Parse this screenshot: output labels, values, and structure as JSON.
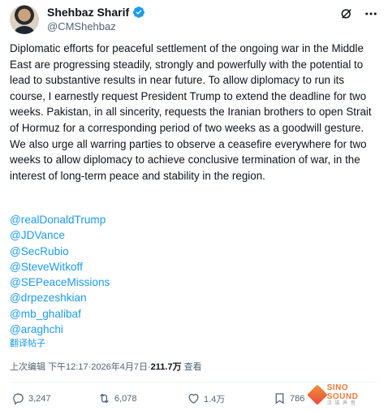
{
  "post": {
    "author": {
      "display_name": "Shehbaz Sharif",
      "handle": "@CMShehbaz",
      "verified": true,
      "verified_color": "#1d9bf0"
    },
    "text": "Diplomatic efforts for peaceful settlement of the ongoing war in the Middle East are progressing steadily, strongly and powerfully with the potential to lead to substantive results in near future. To allow diplomacy to run its course, I earnestly request President Trump to extend the deadline for two weeks. Pakistan, in all sincerity, requests the Iranian brothers to open Strait of Hormuz for a corresponding period of two weeks as a goodwill gesture. We also urge all warring parties to observe a ceasefire everywhere for two weeks to allow diplomacy to achieve conclusive termination of war, in the interest of long-term peace and stability in the region.",
    "mentions": [
      "@realDonaldTrump",
      "@JDVance",
      "@SecRubio",
      "@SteveWitkoff",
      "@SEPeaceMissions",
      "@drpezeshkian",
      "@mb_ghalibaf",
      "@araghchi"
    ],
    "translate_label": "翻译帖子",
    "meta": {
      "edited_label": "上次编辑",
      "time": "下午12:17",
      "separator": " · ",
      "date": "2026年4月7日",
      "views": "211.7万",
      "views_label": "查看"
    },
    "actions": {
      "replies": "3,247",
      "reposts": "6,078",
      "likes": "1.4万",
      "bookmarks": "786"
    }
  },
  "icons": {
    "header": [
      "grok-icon",
      "more-icon"
    ],
    "actions": [
      "reply-icon",
      "repost-icon",
      "like-icon",
      "bookmark-icon"
    ]
  },
  "watermark": {
    "brand": "SINO SOUND",
    "sub": "汉 诺 声 音"
  },
  "colors": {
    "text": "#0f1419",
    "secondary": "#536471",
    "link": "#1d9bf0",
    "accent_watermark": "#e8702a"
  }
}
